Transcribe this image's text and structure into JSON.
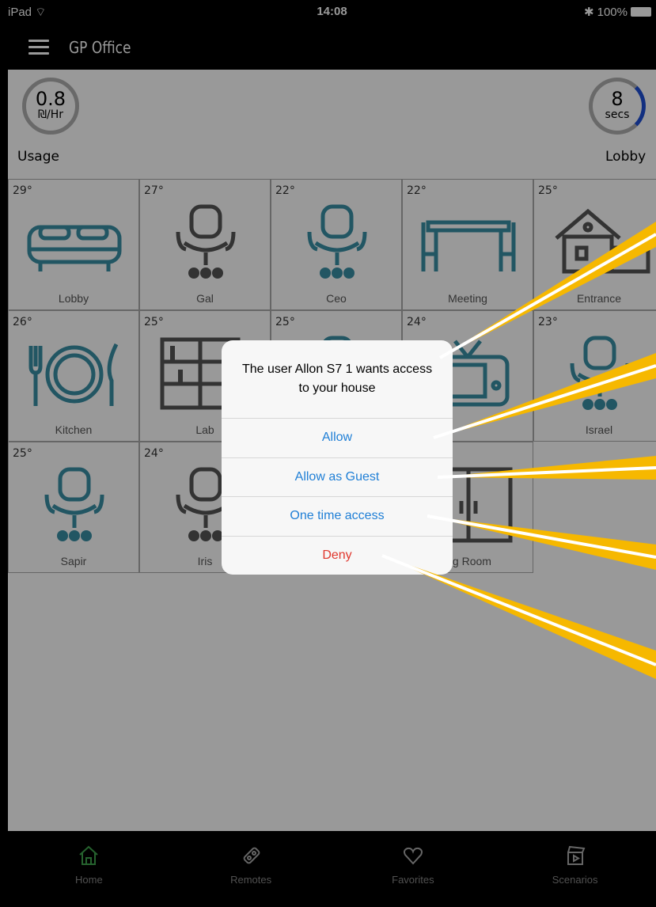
{
  "status": {
    "device": "iPad",
    "time": "14:08",
    "battery": "100%"
  },
  "nav": {
    "title": "GP Office"
  },
  "usage": {
    "value": "0.8",
    "unit": "₪/Hr",
    "label": "Usage"
  },
  "timer": {
    "value": "8",
    "unit": "secs",
    "label": "Lobby"
  },
  "rooms": [
    {
      "temp": "29°",
      "name": "Lobby",
      "icon": "bed-icon",
      "color": "#3a8fa6"
    },
    {
      "temp": "27°",
      "name": "Gal",
      "icon": "office-chair-icon",
      "color": "#555555"
    },
    {
      "temp": "22°",
      "name": "Ceo",
      "icon": "office-chair-icon",
      "color": "#3a8fa6"
    },
    {
      "temp": "22°",
      "name": "Meeting",
      "icon": "meeting-table-icon",
      "color": "#3a8fa6"
    },
    {
      "temp": "25°",
      "name": "Entrance",
      "icon": "house-icon",
      "color": "#555555"
    },
    {
      "temp": "26°",
      "name": "Kitchen",
      "icon": "plate-cutlery-icon",
      "color": "#3a8fa6"
    },
    {
      "temp": "25°",
      "name": "Lab",
      "icon": "bookshelf-icon",
      "color": "#555555"
    },
    {
      "temp": "25°",
      "name": "",
      "icon": "office-chair-icon",
      "color": "#3a8fa6"
    },
    {
      "temp": "24°",
      "name": "",
      "icon": "tv-icon",
      "color": "#3a8fa6"
    },
    {
      "temp": "23°",
      "name": "Israel",
      "icon": "office-chair-icon",
      "color": "#3a8fa6"
    },
    {
      "temp": "25°",
      "name": "Sapir",
      "icon": "office-chair-icon",
      "color": "#3a8fa6"
    },
    {
      "temp": "24°",
      "name": "Iris",
      "icon": "office-chair-icon",
      "color": "#555555"
    },
    {
      "temp": "",
      "name": "",
      "icon": "",
      "color": "#555555"
    },
    {
      "temp": "",
      "name": "ing Room",
      "icon": "glass-door-icon",
      "color": "#555555"
    }
  ],
  "alert": {
    "title": "The user Allon S7  1 wants access to your house",
    "allow": "Allow",
    "allow_guest": "Allow as Guest",
    "one_time": "One time access",
    "deny": "Deny"
  },
  "tabs": [
    {
      "label": "Home",
      "icon": "home-icon"
    },
    {
      "label": "Remotes",
      "icon": "remote-icon"
    },
    {
      "label": "Favorites",
      "icon": "heart-icon"
    },
    {
      "label": "Scenarios",
      "icon": "clapperboard-icon"
    }
  ],
  "colors": {
    "accent": "#1f7fd6",
    "deny": "#e0362c",
    "callout": "#f6b800",
    "home_tab": "#3fa34d"
  }
}
